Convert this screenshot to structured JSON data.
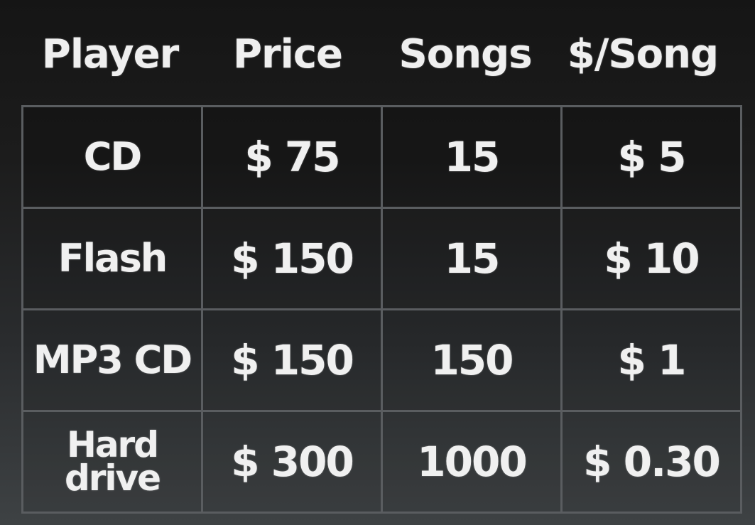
{
  "table": {
    "headers": [
      "Player",
      "Price",
      "Songs",
      "$/Song"
    ],
    "rows": [
      [
        "CD",
        "$ 75",
        "15",
        "$ 5"
      ],
      [
        "Flash",
        "$ 150",
        "15",
        "$ 10"
      ],
      [
        "MP3 CD",
        "$ 150",
        "150",
        "$ 1"
      ],
      [
        "Hard\ndrive",
        "$ 300",
        "1000",
        "$ 0.30"
      ]
    ]
  },
  "colors": {
    "background_top": "#151515",
    "background_bottom": "#3e4244",
    "text": "#efefef",
    "grid_lines": "#5a5d60"
  }
}
